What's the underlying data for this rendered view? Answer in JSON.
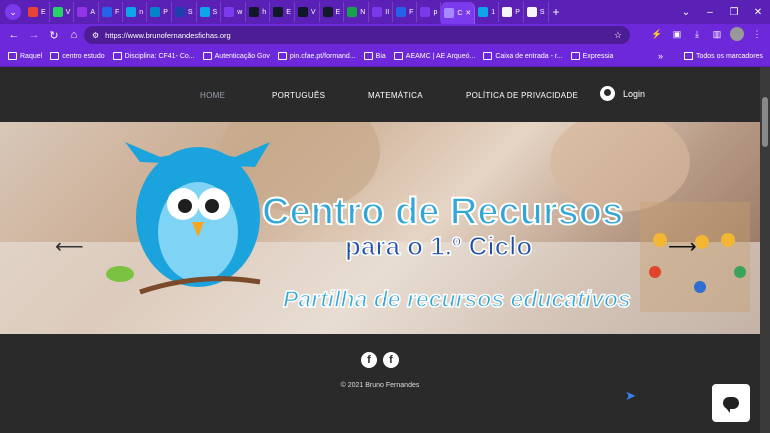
{
  "browser": {
    "tabs": [
      {
        "label": "E",
        "color": "#ea4335"
      },
      {
        "label": "V",
        "color": "#25d366"
      },
      {
        "label": "A",
        "color": "#9333ea"
      },
      {
        "label": "F",
        "color": "#2563eb"
      },
      {
        "label": "n",
        "color": "#0ea5e9"
      },
      {
        "label": "P",
        "color": "#0284c7"
      },
      {
        "label": "S",
        "color": "#1e40af"
      },
      {
        "label": "S",
        "color": "#0ea5e9"
      },
      {
        "label": "w",
        "color": "#7c3aed"
      },
      {
        "label": "h",
        "color": "#111827"
      },
      {
        "label": "E",
        "color": "#111827"
      },
      {
        "label": "V",
        "color": "#111827"
      },
      {
        "label": "E",
        "color": "#111827"
      },
      {
        "label": "N",
        "color": "#16a34a"
      },
      {
        "label": "II",
        "color": "#7c3aed"
      },
      {
        "label": "F",
        "color": "#2563eb"
      },
      {
        "label": "p",
        "color": "#7c3aed"
      },
      {
        "label": "C",
        "color": "#a78bfa"
      },
      {
        "label": "1",
        "color": "#0ea5e9"
      },
      {
        "label": "P",
        "color": "#f5f5f5"
      },
      {
        "label": "S",
        "color": "#f5f5f5"
      }
    ],
    "active_tab_index": 17,
    "url": "https://www.brunofernandesfichas.org",
    "bookmarks": [
      {
        "label": "Raquel"
      },
      {
        "label": "centro estudo"
      },
      {
        "label": "Disciplina: CF41- Co..."
      },
      {
        "label": "Autenticação Gov"
      },
      {
        "label": "pin.cfae.pt/formand..."
      },
      {
        "label": "Bia"
      },
      {
        "label": "AEAMC | AE Arqueó..."
      },
      {
        "label": "Caixa de entrada - r..."
      },
      {
        "label": "Expressia"
      }
    ],
    "all_bookmarks": "Todos os marcadores"
  },
  "site": {
    "nav": [
      "HOME",
      "PORTUGUÊS",
      "MATEMÁTICA",
      "POLÍTICA DE PRIVACIDADE"
    ],
    "login": "Login",
    "hero": {
      "title": "Centro de Recursos",
      "subtitle": "para o 1.º Ciclo",
      "tagline": "Partilha de recursos educativos"
    },
    "social": [
      "f",
      "f"
    ],
    "copyright": "© 2021 Bruno Fernandes"
  }
}
